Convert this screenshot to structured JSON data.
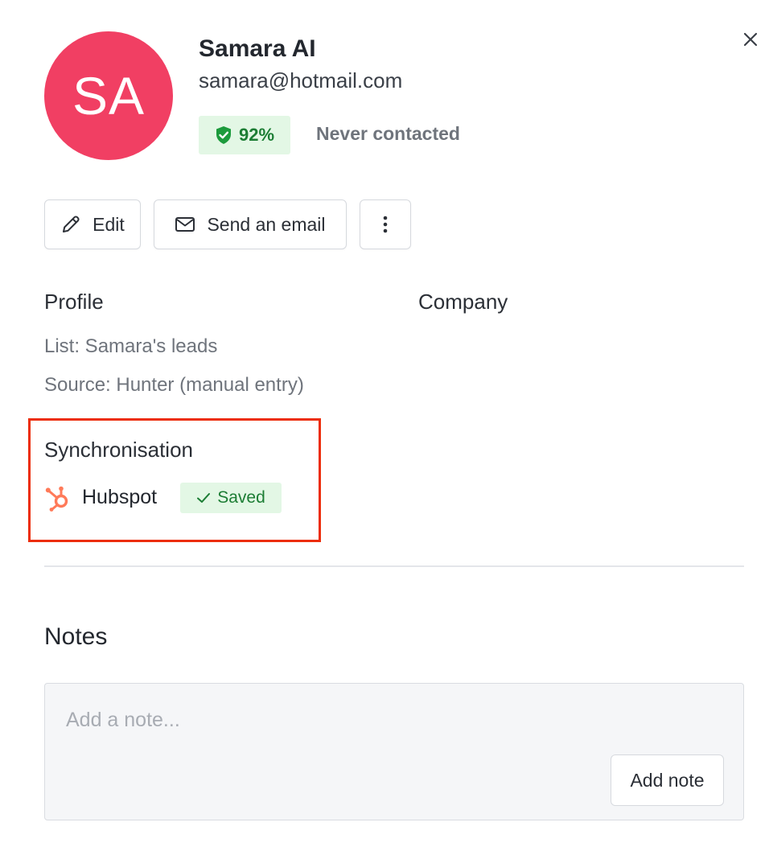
{
  "contact": {
    "initials": "SA",
    "name": "Samara AI",
    "email": "samara@hotmail.com",
    "score": "92%",
    "contact_status": "Never contacted"
  },
  "actions": {
    "edit_label": "Edit",
    "send_email_label": "Send an email"
  },
  "profile": {
    "title": "Profile",
    "list": "List: Samara's leads",
    "source": "Source: Hunter (manual entry)"
  },
  "company": {
    "title": "Company"
  },
  "synchronisation": {
    "title": "Synchronisation",
    "service": "Hubspot",
    "status": "Saved"
  },
  "notes": {
    "title": "Notes",
    "placeholder": "Add a note...",
    "add_label": "Add note"
  },
  "icons": {
    "close": "close-icon",
    "shield": "shield-check-icon",
    "edit": "pencil-icon",
    "email": "envelope-icon",
    "more": "more-vertical-icon",
    "hubspot": "hubspot-logo-icon",
    "check": "check-icon"
  },
  "colors": {
    "avatar": "#f13f63",
    "success_bg": "#e3f7e5",
    "success_text": "#1c7d34",
    "highlight_border": "#ec2d0b",
    "hubspot": "#ff7a59"
  }
}
